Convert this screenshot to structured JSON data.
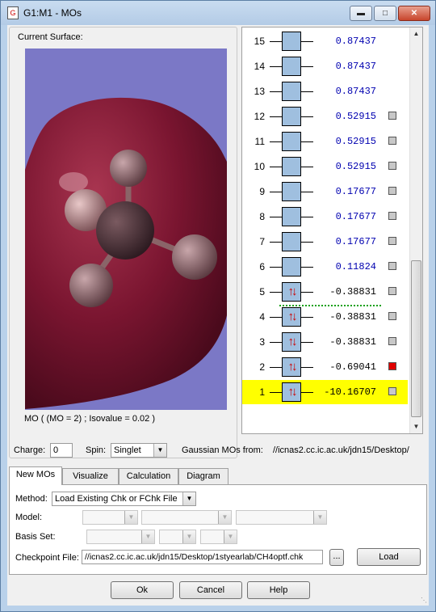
{
  "window": {
    "title": "G1:M1 - MOs",
    "icon": "gaussview-doc-icon"
  },
  "surface": {
    "label": "Current Surface:",
    "caption": "MO ( (MO = 2) ; Isovalue = 0.02 )",
    "background_color": "#7b78c6",
    "lobe_color": "#7a1530"
  },
  "mo_list": {
    "orbitals": [
      {
        "num": "15",
        "energy": "0.87437",
        "occupied": false,
        "has_check": false,
        "checked": false,
        "selected": false
      },
      {
        "num": "14",
        "energy": "0.87437",
        "occupied": false,
        "has_check": false,
        "checked": false,
        "selected": false
      },
      {
        "num": "13",
        "energy": "0.87437",
        "occupied": false,
        "has_check": false,
        "checked": false,
        "selected": false
      },
      {
        "num": "12",
        "energy": "0.52915",
        "occupied": false,
        "has_check": true,
        "checked": false,
        "selected": false
      },
      {
        "num": "11",
        "energy": "0.52915",
        "occupied": false,
        "has_check": true,
        "checked": false,
        "selected": false
      },
      {
        "num": "10",
        "energy": "0.52915",
        "occupied": false,
        "has_check": true,
        "checked": false,
        "selected": false
      },
      {
        "num": "9",
        "energy": "0.17677",
        "occupied": false,
        "has_check": true,
        "checked": false,
        "selected": false
      },
      {
        "num": "8",
        "energy": "0.17677",
        "occupied": false,
        "has_check": true,
        "checked": false,
        "selected": false
      },
      {
        "num": "7",
        "energy": "0.17677",
        "occupied": false,
        "has_check": true,
        "checked": false,
        "selected": false
      },
      {
        "num": "6",
        "energy": "0.11824",
        "occupied": false,
        "has_check": true,
        "checked": false,
        "selected": false
      },
      {
        "num": "5",
        "energy": "-0.38831",
        "occupied": true,
        "has_check": true,
        "checked": false,
        "selected": false
      },
      {
        "num": "4",
        "energy": "-0.38831",
        "occupied": true,
        "has_check": true,
        "checked": false,
        "selected": false
      },
      {
        "num": "3",
        "energy": "-0.38831",
        "occupied": true,
        "has_check": true,
        "checked": false,
        "selected": false
      },
      {
        "num": "2",
        "energy": "-0.69041",
        "occupied": true,
        "has_check": true,
        "checked": true,
        "selected": false
      },
      {
        "num": "1",
        "energy": "-10.16707",
        "occupied": true,
        "has_check": true,
        "checked": false,
        "selected": true
      }
    ],
    "spin_glyph": "↑↓",
    "selected_color": "#ffff00",
    "checked_color": "#e00000",
    "virtual_energy_color": "#0000b0"
  },
  "controls": {
    "charge_label": "Charge:",
    "charge_value": "0",
    "spin_label": "Spin:",
    "spin_value": "Singlet",
    "source_label": "Gaussian MOs from:",
    "source_value": "//icnas2.cc.ic.ac.uk/jdn15/Desktop/"
  },
  "tabs": [
    "New MOs",
    "Visualize",
    "Calculation",
    "Diagram"
  ],
  "new_mos": {
    "method_label": "Method:",
    "method_value": "Load Existing Chk or FChk File",
    "model_label": "Model:",
    "basis_label": "Basis Set:",
    "checkpoint_label": "Checkpoint File:",
    "checkpoint_value": "//icnas2.cc.ic.ac.uk/jdn15/Desktop/1styearlab/CH4optf.chk",
    "browse_label": "...",
    "load_label": "Load"
  },
  "buttons": {
    "ok": "Ok",
    "cancel": "Cancel",
    "help": "Help"
  }
}
